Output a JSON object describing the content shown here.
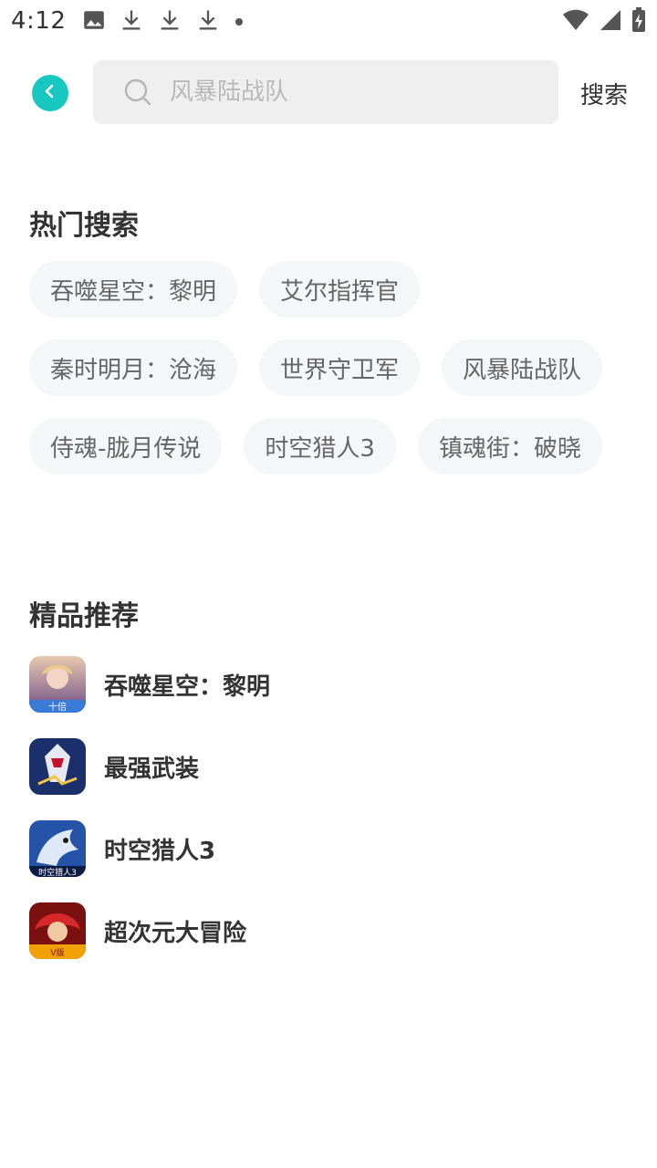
{
  "status_bar": {
    "time": "4:12"
  },
  "header": {
    "search_placeholder": "风暴陆战队",
    "search_button": "搜索",
    "accent_color": "#18c8c0"
  },
  "hot_search": {
    "title": "热门搜索",
    "tags": [
      "吞噬星空：黎明",
      "艾尔指挥官",
      "秦时明月：沧海",
      "世界守卫军",
      "风暴陆战队",
      "侍魂-胧月传说",
      "时空猎人3",
      "镇魂街：破晓"
    ]
  },
  "recommend": {
    "title": "精品推荐",
    "items": [
      {
        "name": "吞噬星空：黎明",
        "icon": "game-icon-tunshi"
      },
      {
        "name": "最强武装",
        "icon": "game-icon-zuiqiang"
      },
      {
        "name": "时空猎人3",
        "icon": "game-icon-shikong"
      },
      {
        "name": "超次元大冒险",
        "icon": "game-icon-chaociyuan"
      }
    ]
  }
}
